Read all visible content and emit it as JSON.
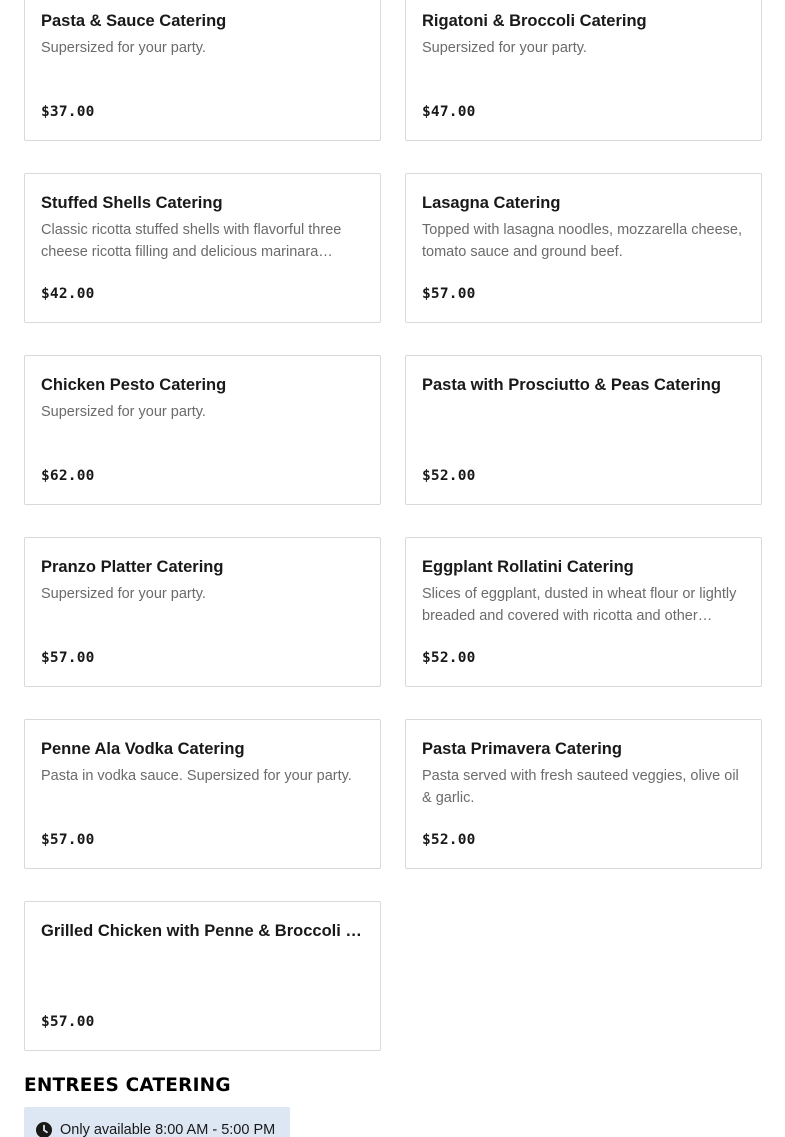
{
  "items": [
    {
      "name": "Pasta & Sauce Catering",
      "description": "Supersized for your party.",
      "price": "$37.00"
    },
    {
      "name": "Rigatoni & Broccoli Catering",
      "description": "Supersized for your party.",
      "price": "$47.00"
    },
    {
      "name": "Stuffed Shells Catering",
      "description": "Classic ricotta stuffed shells with flavorful three cheese ricotta filling and delicious marinara sauce.",
      "price": "$42.00"
    },
    {
      "name": "Lasagna Catering",
      "description": "Topped with lasagna noodles, mozzarella cheese, tomato sauce and ground beef.",
      "price": "$57.00"
    },
    {
      "name": "Chicken Pesto Catering",
      "description": "Supersized for your party.",
      "price": "$62.00"
    },
    {
      "name": "Pasta with Prosciutto & Peas Catering",
      "description": "",
      "price": "$52.00"
    },
    {
      "name": "Pranzo Platter Catering",
      "description": "Supersized for your party.",
      "price": "$57.00"
    },
    {
      "name": "Eggplant Rollatini Catering",
      "description": "Slices of eggplant, dusted in wheat flour or lightly breaded and covered with ricotta and other cheeses.",
      "price": "$52.00"
    },
    {
      "name": "Penne Ala Vodka Catering",
      "description": "Pasta in vodka sauce. Supersized for your party.",
      "price": "$57.00"
    },
    {
      "name": "Pasta Primavera Catering",
      "description": "Pasta served with fresh sauteed veggies, olive oil & garlic.",
      "price": "$52.00"
    },
    {
      "name": "Grilled Chicken with Penne & Broccoli Catering",
      "description": "",
      "price": "$57.00"
    }
  ],
  "section": {
    "title": "ENTREES CATERING",
    "availability": "Only available 8:00 AM - 5:00 PM",
    "availability_icon": "clock-icon"
  },
  "colors": {
    "badge_bg": "#dce7f3",
    "border": "#d9d9d9",
    "desc_text": "#6b6b6b"
  }
}
